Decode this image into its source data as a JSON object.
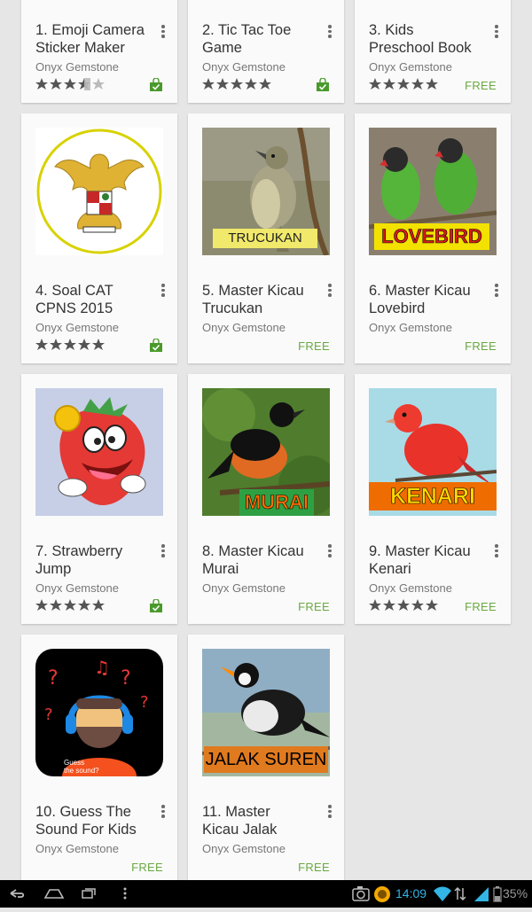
{
  "colors": {
    "free_green": "#6aa842",
    "card_bg": "#fafafa",
    "page_bg": "#e6e6e6",
    "status_blue": "#33b5e5"
  },
  "apps": [
    {
      "title": "1. Emoji Camera\nSticker Maker",
      "developer": "Onyx Gemstone",
      "rating": 3.5,
      "price_type": "installed-bag-icon",
      "free_label": ""
    },
    {
      "title": "2. Tic Tac Toe\nGame",
      "developer": "Onyx Gemstone",
      "rating": 5,
      "price_type": "installed-bag-icon",
      "free_label": ""
    },
    {
      "title": "3. Kids\nPreschool Book",
      "developer": "Onyx Gemstone",
      "rating": 5,
      "price_type": "free",
      "free_label": "FREE"
    },
    {
      "title": "4. Soal CAT\nCPNS 2015",
      "developer": "Onyx Gemstone",
      "rating": 5,
      "price_type": "installed-bag-icon",
      "free_label": "",
      "icon": "garuda-emblem-icon"
    },
    {
      "title": "5. Master Kicau\nTrucukan",
      "developer": "Onyx Gemstone",
      "rating": null,
      "price_type": "free",
      "free_label": "FREE",
      "icon": "bird-photo-trucukan",
      "banner": "TRUCUKAN"
    },
    {
      "title": "6. Master Kicau\nLovebird",
      "developer": "Onyx Gemstone",
      "rating": null,
      "price_type": "free",
      "free_label": "FREE",
      "icon": "bird-photo-lovebird",
      "banner": "LOVEBIRD"
    },
    {
      "title": "7. Strawberry\nJump",
      "developer": "Onyx Gemstone",
      "rating": 5,
      "price_type": "installed-bag-icon",
      "free_label": "",
      "icon": "strawberry-character-icon"
    },
    {
      "title": "8. Master Kicau\nMurai",
      "developer": "Onyx Gemstone",
      "rating": null,
      "price_type": "free",
      "free_label": "FREE",
      "icon": "bird-photo-murai",
      "banner": "MURAI"
    },
    {
      "title": "9. Master Kicau\nKenari",
      "developer": "Onyx Gemstone",
      "rating": 5,
      "price_type": "free",
      "free_label": "FREE",
      "icon": "bird-photo-kenari",
      "banner": "KENARI"
    },
    {
      "title": "10. Guess The\nSound For Kids",
      "developer": "Onyx Gemstone",
      "rating": null,
      "price_type": "free",
      "free_label": "FREE",
      "icon": "guess-sound-icon",
      "caption": "Guess\nthe sound?"
    },
    {
      "title": "11. Master\nKicau Jalak",
      "developer": "Onyx Gemstone",
      "rating": null,
      "price_type": "free",
      "free_label": "FREE",
      "icon": "bird-photo-jalak",
      "banner": "JALAK SUREN"
    }
  ],
  "status_bar": {
    "time": "14:09",
    "battery": "35%"
  },
  "nav": {
    "icons": [
      "back-icon",
      "home-icon",
      "recents-icon",
      "menu-icon"
    ]
  }
}
